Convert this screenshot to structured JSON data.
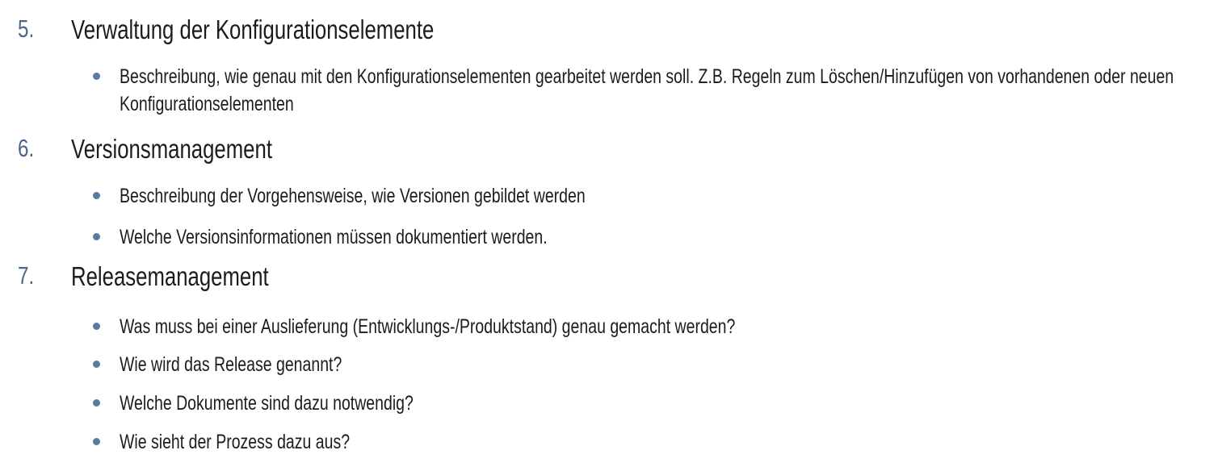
{
  "sections": [
    {
      "number": "5.",
      "title": "Verwaltung der Konfigurationselemente",
      "bullets": [
        "Beschreibung, wie genau mit den Konfigurationselementen gearbeitet werden soll. Z.B. Regeln zum Löschen/Hinzufügen von vorhandenen oder neuen Konfigurationselementen"
      ]
    },
    {
      "number": "6.",
      "title": "Versionsmanagement",
      "bullets": [
        "Beschreibung der Vorgehensweise, wie Versionen gebildet werden",
        "Welche Versionsinformationen müssen dokumentiert werden."
      ]
    },
    {
      "number": "7.",
      "title": "Releasemanagement",
      "bullets": [
        "Was muss bei einer Auslieferung (Entwicklungs-/Produktstand) genau gemacht werden?",
        "Wie wird das Release genannt?",
        "Welche Dokumente sind dazu notwendig?",
        "Wie sieht der Prozess dazu aus?"
      ]
    }
  ],
  "colors": {
    "number": "#4a6688",
    "bullet": "#5b7aa1",
    "text": "#1c1c1c"
  }
}
